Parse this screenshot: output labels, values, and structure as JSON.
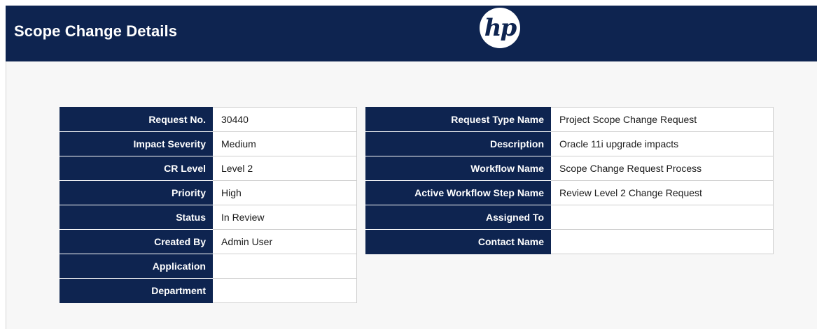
{
  "header": {
    "title": "Scope Change Details",
    "logo_text": "hp",
    "background_color": "#0e2450"
  },
  "left_table": [
    {
      "label": "Request No.",
      "value": "30440"
    },
    {
      "label": "Impact Severity",
      "value": "Medium"
    },
    {
      "label": "CR Level",
      "value": "Level 2"
    },
    {
      "label": "Priority",
      "value": "High"
    },
    {
      "label": "Status",
      "value": "In Review"
    },
    {
      "label": "Created By",
      "value": "Admin User"
    },
    {
      "label": "Application",
      "value": ""
    },
    {
      "label": "Department",
      "value": ""
    }
  ],
  "right_table": [
    {
      "label": "Request Type Name",
      "value": "Project Scope Change Request"
    },
    {
      "label": "Description",
      "value": "Oracle 11i upgrade impacts"
    },
    {
      "label": "Workflow Name",
      "value": "Scope Change Request Process"
    },
    {
      "label": "Active Workflow Step Name",
      "value": "Review Level 2 Change Request"
    },
    {
      "label": "Assigned To",
      "value": ""
    },
    {
      "label": "Contact Name",
      "value": ""
    }
  ]
}
